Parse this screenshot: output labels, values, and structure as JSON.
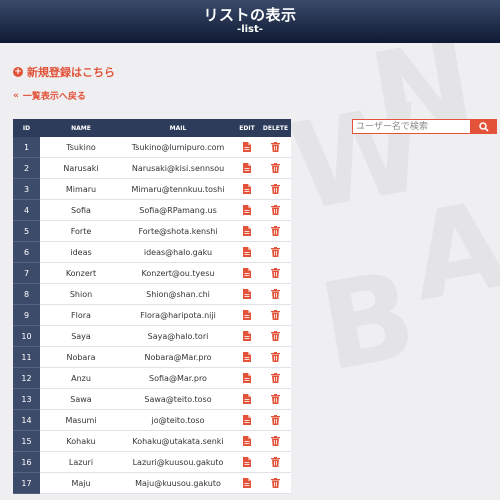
{
  "header": {
    "title": "リストの表示",
    "subtitle": "-list-"
  },
  "links": {
    "register": "新規登録はこちら",
    "back": "一覧表示へ戻る"
  },
  "search": {
    "placeholder": "ユーザー名で検索"
  },
  "table": {
    "headers": [
      "ID",
      "NAME",
      "MAIL",
      "EDIT",
      "DELETE"
    ],
    "rows": [
      {
        "id": "1",
        "name": "Tsukino",
        "mail": "Tsukino@lumipuro.com"
      },
      {
        "id": "2",
        "name": "Narusaki",
        "mail": "Narusaki@kisi.sennsou"
      },
      {
        "id": "3",
        "name": "Mimaru",
        "mail": "Mimaru@tennkuu.toshi"
      },
      {
        "id": "4",
        "name": "Sofia",
        "mail": "Sofia@RPamang.us"
      },
      {
        "id": "5",
        "name": "Forte",
        "mail": "Forte@shota.kenshi"
      },
      {
        "id": "6",
        "name": "ideas",
        "mail": "ideas@halo.gaku"
      },
      {
        "id": "7",
        "name": "Konzert",
        "mail": "Konzert@ou.tyesu"
      },
      {
        "id": "8",
        "name": "Shion",
        "mail": "Shion@shan.chi"
      },
      {
        "id": "9",
        "name": "Flora",
        "mail": "Flora@haripota.niji"
      },
      {
        "id": "10",
        "name": "Saya",
        "mail": "Saya@halo.tori"
      },
      {
        "id": "11",
        "name": "Nobara",
        "mail": "Nobara@Mar.pro"
      },
      {
        "id": "12",
        "name": "Anzu",
        "mail": "Sofia@Mar.pro"
      },
      {
        "id": "13",
        "name": "Sawa",
        "mail": "Sawa@teito.toso"
      },
      {
        "id": "14",
        "name": "Masumi",
        "mail": "jo@teito.toso"
      },
      {
        "id": "15",
        "name": "Kohaku",
        "mail": "Kohaku@utakata.senki"
      },
      {
        "id": "16",
        "name": "Lazuri",
        "mail": "Lazuri@kuusou.gakuto"
      },
      {
        "id": "17",
        "name": "Maju",
        "mail": "Maju@kuusou.gakuto"
      }
    ]
  },
  "colors": {
    "accent": "#e2533a",
    "header_dark": "#0f1a33",
    "table_header": "#2e3c5c",
    "id_cell": "#3d4b6b"
  },
  "icons": {
    "register": "plus-circle-icon",
    "back": "double-chevron-left-icon",
    "search": "search-icon",
    "edit": "edit-document-icon",
    "delete": "trash-icon"
  }
}
